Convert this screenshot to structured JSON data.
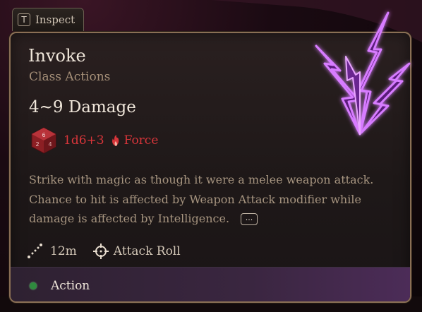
{
  "inspect_tab": {
    "key": "T",
    "label": "Inspect"
  },
  "spell": {
    "name": "Invoke",
    "category": "Class Actions",
    "damage_summary": "4~9 Damage",
    "dice": "1d6+3",
    "damage_type": "Force",
    "description_lines": [
      "Strike with magic as though it were a melee weapon attack.",
      "Chance to hit is affected by Weapon Attack modifier while",
      "damage is affected by Intelligence."
    ],
    "more_button": "...",
    "range": "12m",
    "attack_type": "Attack Roll",
    "cost": "Action"
  },
  "colors": {
    "damage_red": "#d8353a",
    "action_green": "#2f8a3e",
    "bolt_purple": "#c35bff"
  }
}
